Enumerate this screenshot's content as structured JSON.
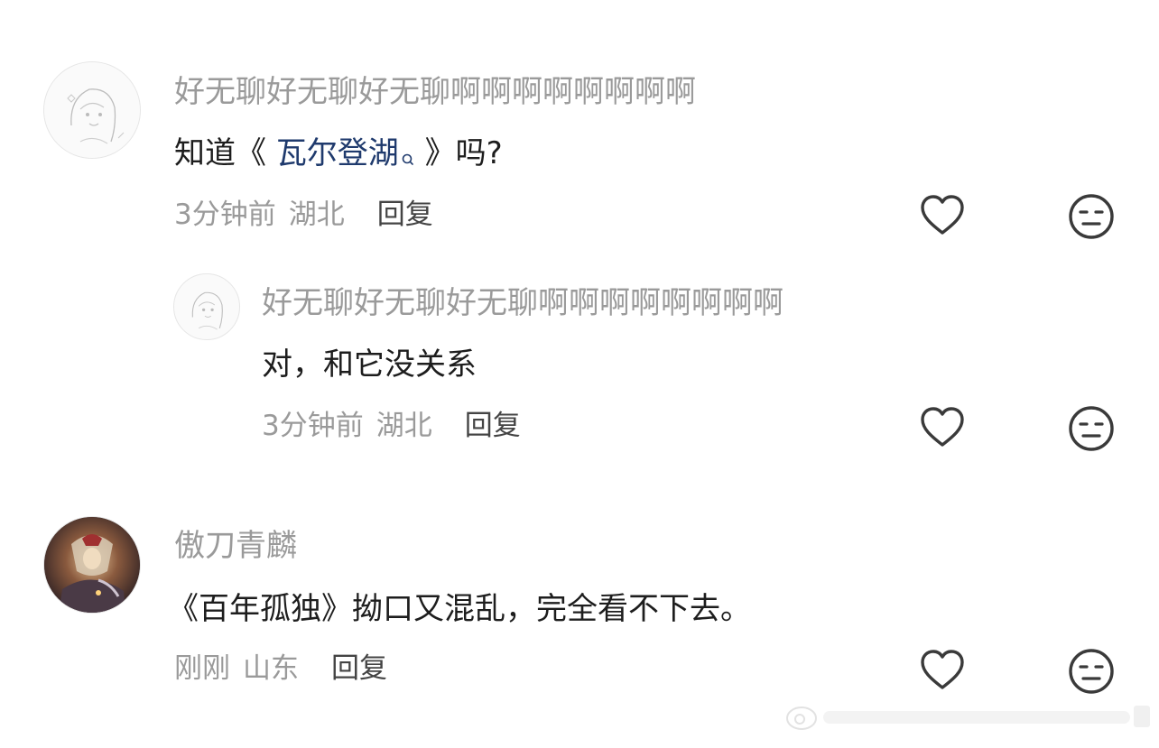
{
  "comments": [
    {
      "username": "好无聊好无聊好无聊啊啊啊啊啊啊啊啊",
      "content_pre": "知道《 ",
      "content_link": "瓦尔登湖",
      "content_post": " 》吗?",
      "time": "3分钟前",
      "location": "湖北",
      "reply_label": "回复",
      "avatar_icon": "line-art-girl-avatar",
      "replies": [
        {
          "username": "好无聊好无聊好无聊啊啊啊啊啊啊啊啊",
          "content": "对，和它没关系",
          "time": "3分钟前",
          "location": "湖北",
          "reply_label": "回复",
          "avatar_icon": "line-art-girl-avatar"
        }
      ]
    },
    {
      "username": "傲刀青麟",
      "content": "《百年孤独》拗口又混乱，完全看不下去。",
      "time": "刚刚",
      "location": "山东",
      "reply_label": "回复",
      "avatar_icon": "anime-character-avatar"
    }
  ],
  "icons": {
    "like": "heart-outline-icon",
    "dislike": "neutral-face-icon",
    "search_sup": "search-icon"
  },
  "colors": {
    "username": "#9a9a9a",
    "content": "#1d1d1d",
    "link": "#1f3a6d",
    "meta": "#9a9a9a",
    "reply": "#444444",
    "icon": "#3a3a3a"
  }
}
